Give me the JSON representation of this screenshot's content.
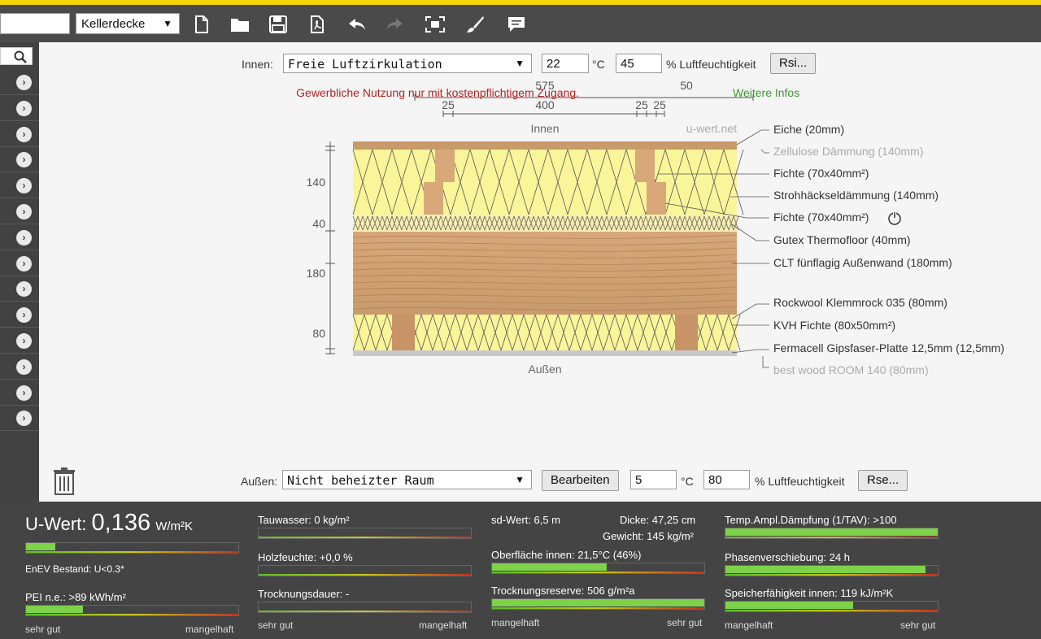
{
  "toolbar": {
    "project_value": "",
    "construction_select": "Kellerdecke",
    "icons": [
      "new-file-icon",
      "open-folder-icon",
      "save-icon",
      "pdf-icon",
      "undo-icon",
      "redo-icon",
      "fit-screen-icon",
      "brush-icon",
      "comment-icon"
    ]
  },
  "sidebar": {
    "row_count": 14
  },
  "inside": {
    "label": "Innen:",
    "climate": "Freie Luftzirkulation",
    "temp": "22",
    "temp_unit": "°C",
    "humidity": "45",
    "humidity_label": "% Luftfeuchtigkeit",
    "rsi_button": "Rsi..."
  },
  "outside": {
    "label": "Außen:",
    "climate": "Nicht beheizter Raum",
    "edit_button": "Bearbeiten",
    "temp": "5",
    "temp_unit": "°C",
    "humidity": "80",
    "humidity_label": "% Luftfeuchtigkeit",
    "rse_button": "Rse..."
  },
  "notice": {
    "text": "Gewerbliche Nutzung nur mit kostenpflichtigem Zugang.",
    "link": "Weitere Infos"
  },
  "diagram": {
    "dims_top": {
      "total": "575",
      "d1": "25",
      "d2": "400",
      "d3": "25",
      "d4": "25",
      "d5": "50"
    },
    "inside_label": "Innen",
    "outside_label": "Außen",
    "watermark": "u-wert.net",
    "left_dims": [
      "140",
      "40",
      "180",
      "80"
    ],
    "layers": [
      {
        "label": "Eiche (20mm)",
        "muted": false
      },
      {
        "label": "Zellulose Dämmung (140mm)",
        "muted": true
      },
      {
        "label": "Fichte (70x40mm²)",
        "muted": false
      },
      {
        "label": "Strohhäckseldämmung (140mm)",
        "muted": false
      },
      {
        "label": "Fichte (70x40mm²)",
        "muted": false
      },
      {
        "label": "Gutex Thermofloor (40mm)",
        "muted": false
      },
      {
        "label": "CLT fünflagig Außenwand (180mm)",
        "muted": false
      },
      {
        "label": "Rockwool Klemmrock 035 (80mm)",
        "muted": false
      },
      {
        "label": "KVH Fichte (80x50mm²)",
        "muted": false
      },
      {
        "label": "Fermacell Gipsfaser-Platte 12,5mm (12,5mm)",
        "muted": false
      },
      {
        "label": "best wood ROOM 140 (80mm)",
        "muted": true
      }
    ]
  },
  "results": {
    "u_label": "U-Wert:",
    "u_value": "0,136",
    "u_unit": "W/m²K",
    "u_fill": 0.14,
    "enev": "EnEV Bestand: U<0.3*",
    "pei": "PEI n.e.: >89 kWh/m²",
    "pei_fill": 0.27,
    "tauwasser": "Tauwasser: 0 kg/m²",
    "tauwasser_fill": 0.0,
    "holzfeuchte": "Holzfeuchte: +0,0 %",
    "holzfeuchte_fill": 0.0,
    "trocknungsdauer": "Trocknungsdauer: -",
    "trocknungsdauer_fill": 0.0,
    "sd": "sd-Wert: 6,5 m",
    "dicke": "Dicke: 47,25 cm",
    "gewicht": "Gewicht: 145 kg/m²",
    "oberflaeche": "Oberfläche innen: 21,5°C (46%)",
    "oberflaeche_fill": 0.54,
    "reserve": "Trocknungsreserve: 506 g/m²a",
    "reserve_fill": 1.0,
    "tav": "Temp.Ampl.Dämpfung (1/TAV): >100",
    "tav_fill": 1.0,
    "phase": "Phasenverschiebung: 24 h",
    "phase_fill": 0.94,
    "speicher": "Speicherfähigkeit innen: 119 kJ/m²K",
    "speicher_fill": 0.6,
    "good": "sehr gut",
    "bad": "mangelhaft"
  }
}
